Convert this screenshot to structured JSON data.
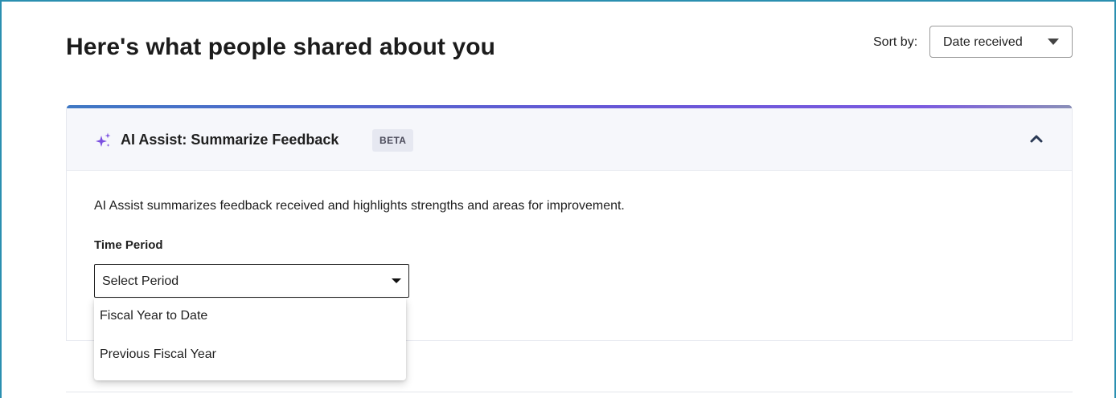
{
  "page": {
    "title": "Here's what people shared about you"
  },
  "sort": {
    "label": "Sort by:",
    "selected": "Date received"
  },
  "ai_assist": {
    "title": "AI Assist: Summarize Feedback",
    "badge": "BETA",
    "description": "AI Assist summarizes feedback received and highlights strengths and areas for improvement.",
    "time_period": {
      "label": "Time Period",
      "selected": "Select Period",
      "options": [
        "Fiscal Year to Date",
        "Previous Fiscal Year"
      ]
    }
  },
  "colors": {
    "frame_border": "#2a8fb0",
    "sparkle": "#7b4fe0",
    "accent_gradient_start": "#3f78c4",
    "accent_gradient_end": "#7b5ae0",
    "header_bg": "#f6f7fb",
    "badge_bg": "#e6e8f1"
  },
  "icons": {
    "sparkle": "sparkle-icon",
    "collapse": "chevron-up-icon",
    "sort_caret": "caret-down-icon",
    "period_caret": "caret-down-icon"
  }
}
